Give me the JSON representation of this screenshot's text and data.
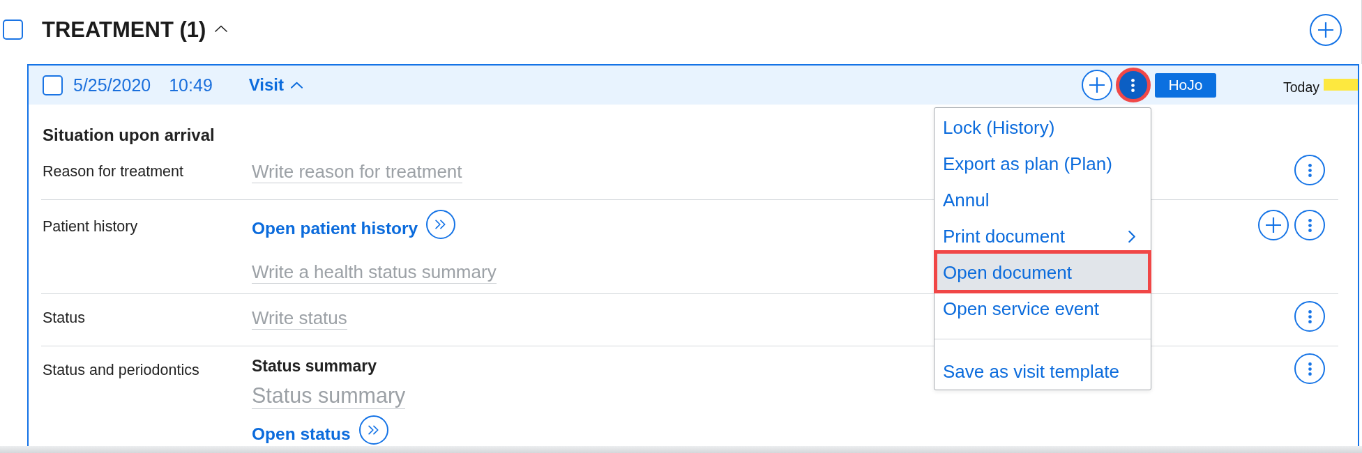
{
  "section": {
    "title": "TREATMENT (1)",
    "checked": false,
    "expanded": true
  },
  "visit": {
    "checked": false,
    "date": "5/25/2020",
    "time": "10:49",
    "type": "Visit",
    "expanded": true,
    "more_button_annotated": true,
    "user": "HoJo",
    "day": "Today"
  },
  "menu": {
    "groups": [
      [
        {
          "label": "Lock (History)",
          "submenu": false,
          "selected": false,
          "annotated": false
        },
        {
          "label": "Export as plan (Plan)",
          "submenu": false,
          "selected": false,
          "annotated": false
        },
        {
          "label": "Annul",
          "submenu": false,
          "selected": false,
          "annotated": false
        },
        {
          "label": "Print document",
          "submenu": true,
          "selected": false,
          "annotated": false
        },
        {
          "label": "Open document",
          "submenu": false,
          "selected": true,
          "annotated": true
        },
        {
          "label": "Open service event",
          "submenu": false,
          "selected": false,
          "annotated": false
        }
      ],
      [
        {
          "label": "Save as visit template",
          "submenu": false,
          "selected": false,
          "annotated": false
        }
      ]
    ]
  },
  "form": {
    "heading": "Situation upon arrival",
    "rows": [
      {
        "kind": "text",
        "label": "Reason for treatment",
        "addable": false,
        "placeholder": "Write reason for treatment"
      },
      {
        "kind": "history",
        "label": "Patient history",
        "addable": true,
        "link": "Open patient history",
        "placeholder": "Write a health status summary"
      },
      {
        "kind": "text",
        "label": "Status",
        "addable": false,
        "placeholder": "Write status"
      },
      {
        "kind": "status",
        "label": "Status and periodontics",
        "addable": false,
        "subheading": "Status summary",
        "placeholder": "Status summary",
        "link": "Open status"
      }
    ]
  }
}
